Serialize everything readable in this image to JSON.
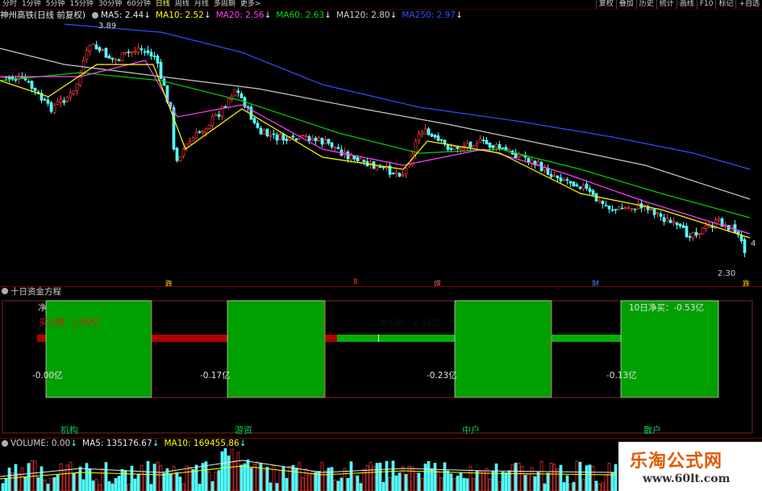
{
  "toolbar": {
    "periods": [
      "分时",
      "1分钟",
      "5分钟",
      "15分钟",
      "30分钟",
      "60分钟",
      "日线",
      "周线",
      "月线",
      "多周期",
      "更多>"
    ],
    "active_period": "日线",
    "right_buttons": [
      "复权",
      "叠加",
      "历史",
      "统计",
      "画线",
      "F10",
      "标记",
      "+自选"
    ]
  },
  "main_chart": {
    "title": "神州高铁(日线 前复权)",
    "ma": [
      {
        "label": "MA5: 2.44",
        "arrow": "↓",
        "color": "#e8e8e8"
      },
      {
        "label": "MA10: 2.52",
        "arrow": "↓",
        "color": "#ffff00"
      },
      {
        "label": "MA20: 2.56",
        "arrow": "↓",
        "color": "#ff40ff"
      },
      {
        "label": "MA60: 2.63",
        "arrow": "↓",
        "color": "#00e000"
      },
      {
        "label": "MA120: 2.80",
        "arrow": "↓",
        "color": "#d0d0d0"
      },
      {
        "label": "MA250: 2.97",
        "arrow": "↓",
        "color": "#3050ff"
      }
    ],
    "high_label": "3.89",
    "low_label": "2.30",
    "right_edge_label": "4",
    "markers": [
      {
        "text": "跌",
        "color": "#ffcc00"
      },
      {
        "text": "8",
        "color": "#ff3030"
      },
      {
        "text": "增",
        "color": "#ff6060"
      },
      {
        "text": "财",
        "color": "#5080ff"
      },
      {
        "text": "跌",
        "color": "#ffcc00"
      }
    ]
  },
  "fund_panel": {
    "title": "十日资金方程",
    "net_label": "净",
    "buy_label": "买入额：1.99亿",
    "sell_label": "卖出额：2.38亿",
    "net10_label": "10日净买：-0.53亿",
    "segment_values": [
      "-0.00亿",
      "-0.17亿",
      "-0.23亿",
      "-0.13亿"
    ],
    "categories": [
      "机构",
      "游资",
      "中户",
      "散户"
    ]
  },
  "volume_panel": {
    "title": "VOLUME: 0.00",
    "title_arrow": "↓",
    "ma5": "MA5: 135176.67",
    "ma5_arrow": "↓",
    "ma10": "MA10: 169455.86",
    "ma10_arrow": "↓"
  },
  "watermark": {
    "title": "乐淘公式网",
    "url": "www.60lt.com"
  },
  "colors": {
    "up": "#ff3a3a",
    "down": "#54ffff",
    "green_box": "#00a000",
    "red_bar": "#b00000"
  }
}
